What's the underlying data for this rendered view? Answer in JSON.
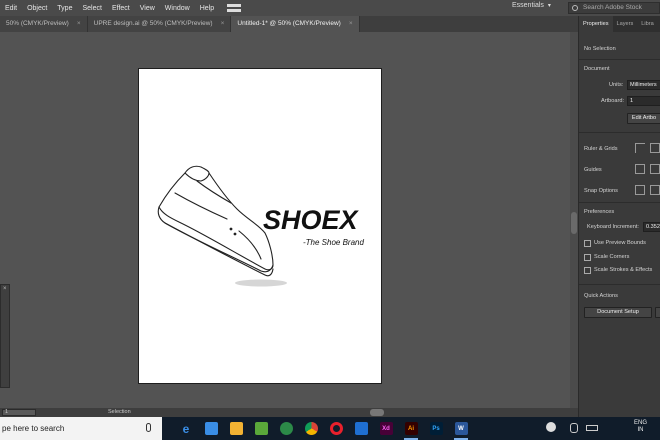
{
  "menu": [
    "Edit",
    "Object",
    "Type",
    "Select",
    "Effect",
    "View",
    "Window",
    "Help"
  ],
  "workspace": "Essentials",
  "search_placeholder": "Search Adobe Stock",
  "tabs": [
    {
      "label": "50% (CMYK/Preview)",
      "active": false
    },
    {
      "label": "UPRE design.ai @ 50% (CMYK/Preview)",
      "active": false
    },
    {
      "label": "Untitled-1* @ 50% (CMYK/Preview)",
      "active": true
    }
  ],
  "tab_close": "×",
  "artwork": {
    "brand": "SHOEX",
    "tagline": "-The Shoe Brand"
  },
  "status": {
    "zoom": "1",
    "mode": "Selection"
  },
  "panel": {
    "tabs": [
      "Properties",
      "Layers",
      "Libra"
    ],
    "no_selection": "No Selection",
    "document": "Document",
    "units_label": "Units:",
    "units_value": "Millimeters",
    "artboard_label": "Artboard:",
    "artboard_value": "1",
    "edit_artboards": "Edit Artbo",
    "ruler_grids": "Ruler & Grids",
    "guides": "Guides",
    "snap_options": "Snap Options",
    "preferences": "Preferences",
    "keyboard_increment_label": "Keyboard Increment:",
    "keyboard_increment_value": "0.352",
    "use_preview_bounds": "Use Preview Bounds",
    "scale_corners": "Scale Corners",
    "scale_strokes": "Scale Strokes & Effects",
    "quick_actions": "Quick Actions",
    "document_setup": "Document Setup"
  },
  "taskbar": {
    "search": "pe here to search",
    "lang_top": "ENG",
    "lang_bottom": "IN",
    "icons": [
      "edge-icon",
      "store-icon",
      "shopping-bag-icon",
      "greenshot-icon",
      "tripadvisor-icon",
      "chrome-icon",
      "opera-icon",
      "mail-icon",
      "xd-icon",
      "illustrator-icon",
      "photoshop-icon",
      "word-icon"
    ]
  },
  "colors": {
    "accent": "#2d8ceb",
    "canvas": "#535353",
    "panel": "#3a3a3a"
  }
}
